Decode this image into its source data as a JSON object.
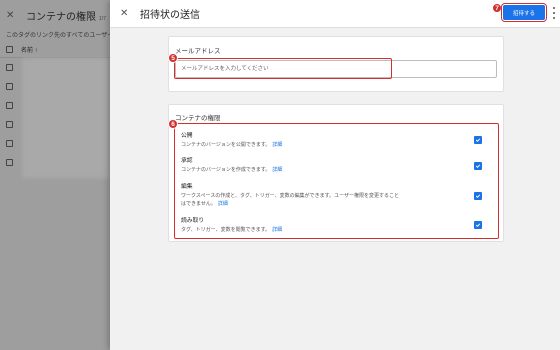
{
  "background_panel": {
    "title": "コンテナの権限",
    "title_suffix": "1/7",
    "description": "このタグのリンク先のすべてのユーザーに対",
    "column_header": "名前 ↑",
    "row_count": 6
  },
  "dialog": {
    "title": "招待状の送信",
    "invite_button": "招待する",
    "email_section": {
      "label": "メールアドレス",
      "placeholder": "メールアドレスを入力してください"
    },
    "permissions_section": {
      "title": "コンテナの権限",
      "items": [
        {
          "title": "公開",
          "description": "コンテナのバージョンを公開できます。",
          "link": "詳細",
          "checked": true
        },
        {
          "title": "承認",
          "description": "コンテナのバージョンを作成できます。",
          "link": "詳細",
          "checked": true
        },
        {
          "title": "編集",
          "description_line1": "ワークスペースの作成と、タグ、トリガー、変数の編集ができます。ユーザー権限を変更すること",
          "description_line2": "はできません。",
          "link": "詳細",
          "checked": true
        },
        {
          "title": "読み取り",
          "description": "タグ、トリガー、変数を閲覧できます。",
          "link": "詳細",
          "checked": true
        }
      ]
    }
  },
  "annotations": {
    "marker_email": "5",
    "marker_permissions": "6",
    "marker_invite": "7"
  },
  "colors": {
    "accent": "#1a73e8",
    "annotation": "#d32f2f",
    "overlay": "#9e9e9e"
  }
}
